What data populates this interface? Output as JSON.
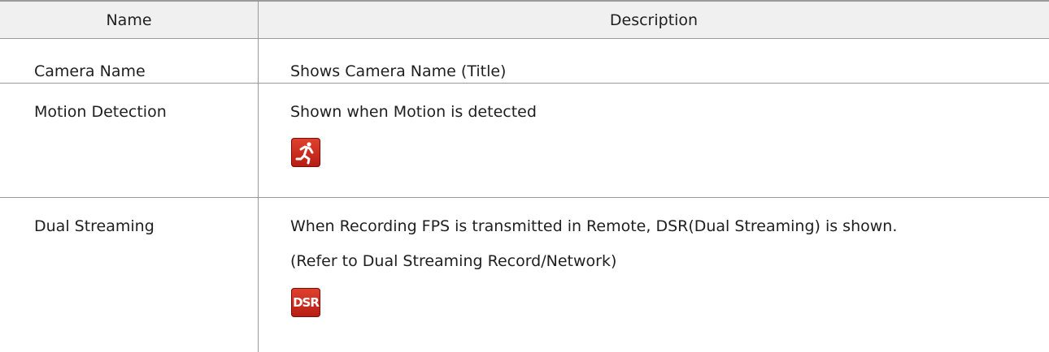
{
  "table": {
    "headers": {
      "name": "Name",
      "description": "Description"
    },
    "rows": [
      {
        "name": "Camera Name",
        "description_lines": [
          "Shows Camera Name (Title)"
        ]
      },
      {
        "name": "Motion Detection",
        "description_lines": [
          "Shown when Motion is detected"
        ],
        "icon": "running-man-icon"
      },
      {
        "name": "Dual Streaming",
        "description_lines": [
          "When Recording FPS is transmitted in Remote, DSR(Dual Streaming) is shown.",
          "(Refer to Dual Streaming Record/Network)"
        ],
        "icon": "dsr-icon",
        "icon_text": "DSR"
      }
    ]
  },
  "colors": {
    "header_bg": "#f0f0f0",
    "border": "#9a9a9a",
    "icon_red": "#cc2a1d"
  }
}
